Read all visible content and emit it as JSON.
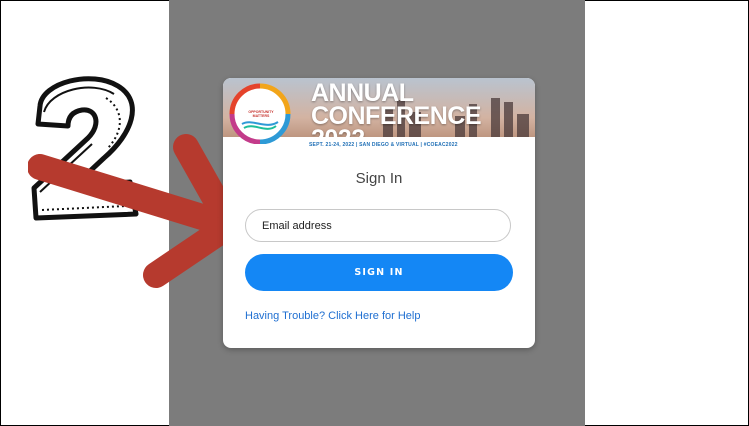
{
  "colors": {
    "overlay": "#7c7c7c",
    "accent": "#1487f5",
    "link": "#1f6fd1",
    "arrow": "#b63a2e"
  },
  "annotation": {
    "step_number": "2",
    "arrow_icon": "right-arrow-icon"
  },
  "banner": {
    "title_line1": "ANNUAL",
    "title_line2": "CONFERENCE 2022",
    "tagline": "SEPT. 21-24, 2022 | SAN DIEGO & VIRTUAL | #COEAC2022",
    "logo_text": "OPPORTUNITY MATTERS"
  },
  "login": {
    "heading": "Sign In",
    "email_placeholder": "Email address",
    "signin_label": "SIGN IN",
    "help_text": "Having Trouble? Click Here for Help"
  }
}
